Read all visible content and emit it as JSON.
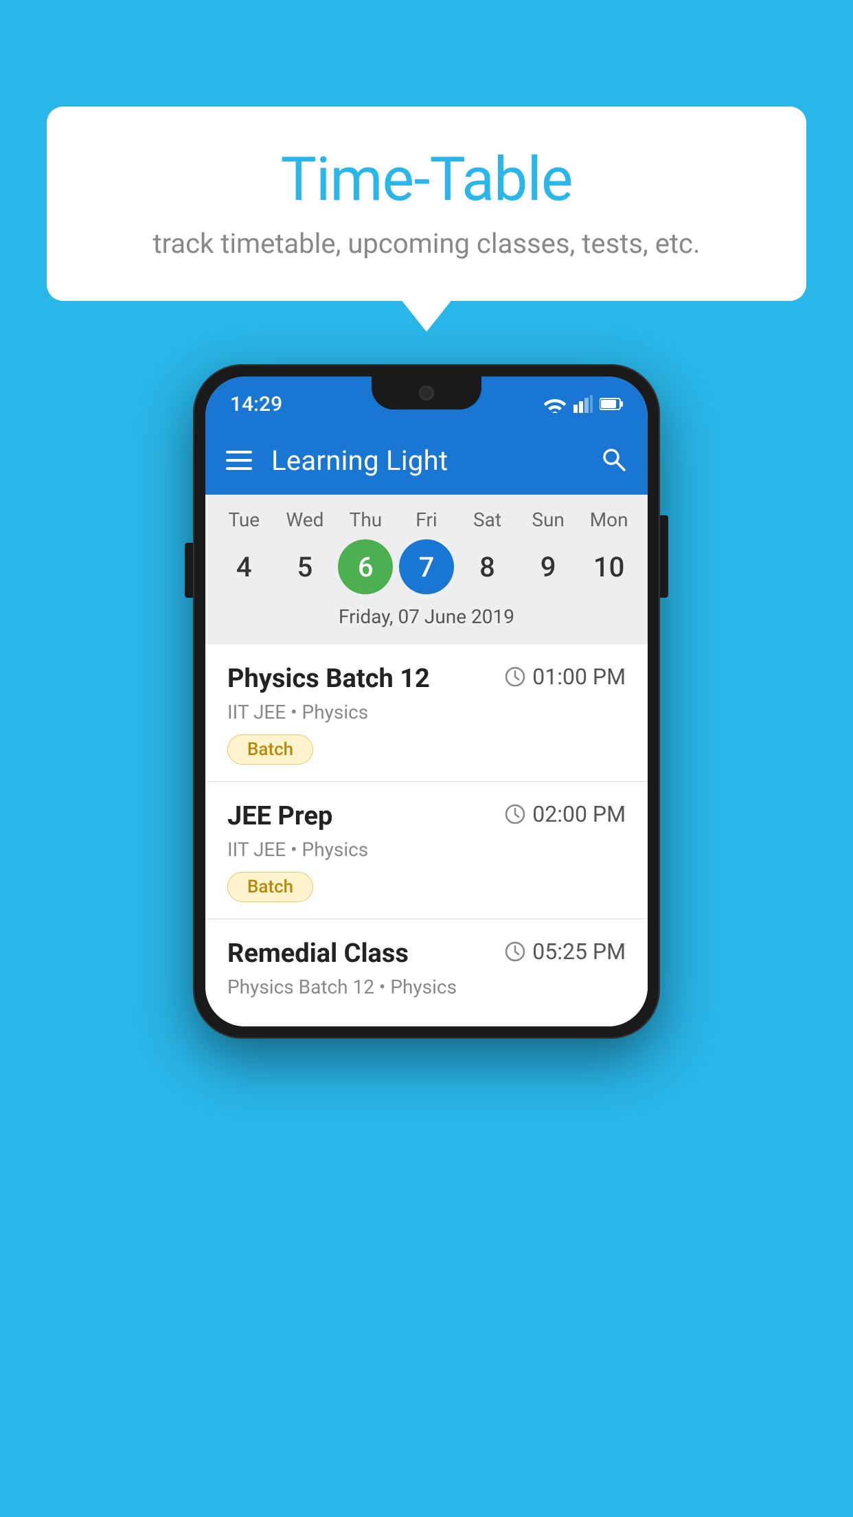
{
  "background_color": "#29b6e8",
  "speech_bubble": {
    "title": "Time-Table",
    "subtitle": "track timetable, upcoming classes, tests, etc."
  },
  "phone": {
    "status_bar": {
      "time": "14:29"
    },
    "app_bar": {
      "title": "Learning Light"
    },
    "calendar": {
      "days": [
        {
          "label": "Tue",
          "number": "4"
        },
        {
          "label": "Wed",
          "number": "5"
        },
        {
          "label": "Thu",
          "number": "6",
          "state": "today"
        },
        {
          "label": "Fri",
          "number": "7",
          "state": "selected"
        },
        {
          "label": "Sat",
          "number": "8"
        },
        {
          "label": "Sun",
          "number": "9"
        },
        {
          "label": "Mon",
          "number": "10"
        }
      ],
      "selected_date": "Friday, 07 June 2019"
    },
    "schedule": [
      {
        "name": "Physics Batch 12",
        "time": "01:00 PM",
        "sub": "IIT JEE • Physics",
        "badge": "Batch"
      },
      {
        "name": "JEE Prep",
        "time": "02:00 PM",
        "sub": "IIT JEE • Physics",
        "badge": "Batch"
      },
      {
        "name": "Remedial Class",
        "time": "05:25 PM",
        "sub": "Physics Batch 12 • Physics",
        "badge": null
      }
    ]
  }
}
